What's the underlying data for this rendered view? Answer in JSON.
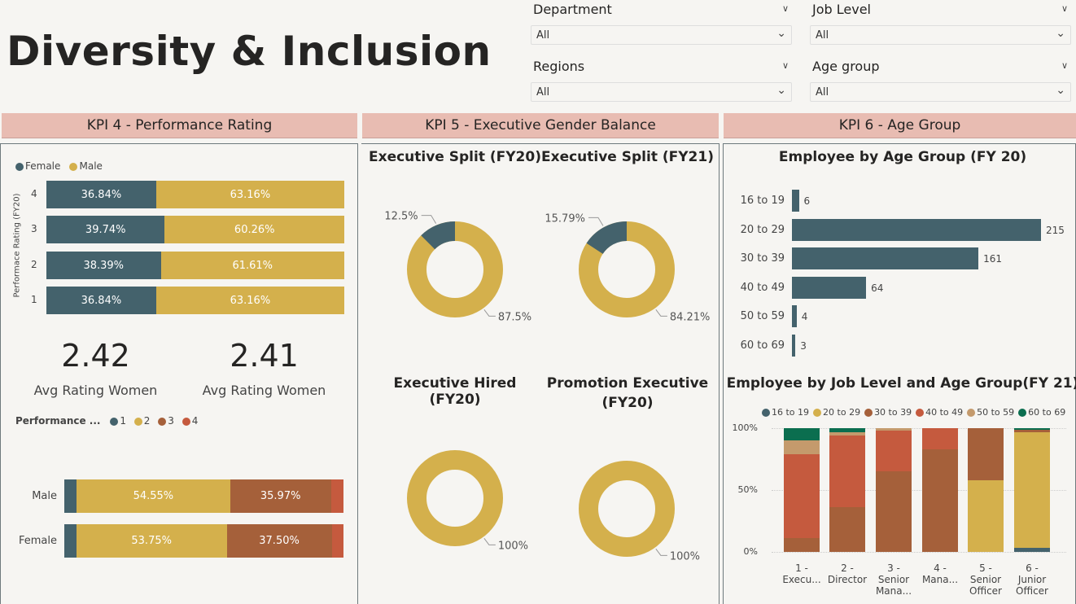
{
  "header": {
    "title": "Diversity & Inclusion"
  },
  "filters": [
    {
      "label": "Department",
      "value": "All"
    },
    {
      "label": "Job Level",
      "value": "All"
    },
    {
      "label": "Regions",
      "value": "All"
    },
    {
      "label": "Age group",
      "value": "All"
    }
  ],
  "kpi_headers": {
    "kpi4": "KPI 4 - Performance Rating",
    "kpi5": "KPI 5 - Executive Gender Balance",
    "kpi6": "KPI 6 - Age Group"
  },
  "colors": {
    "teal": "#44626c",
    "gold": "#d4b04c",
    "brown": "#a5603a",
    "red": "#c55a3e",
    "tan": "#c49a6c",
    "green": "#0b6e4f"
  },
  "perf_chart": {
    "legend": [
      "Female",
      "Male"
    ],
    "y_axis_label": "Performace Rating (FY20)",
    "rows": [
      {
        "rating": "4",
        "female": "36.84%",
        "male": "63.16%",
        "f": 36.84
      },
      {
        "rating": "3",
        "female": "39.74%",
        "male": "60.26%",
        "f": 39.74
      },
      {
        "rating": "2",
        "female": "38.39%",
        "male": "61.61%",
        "f": 38.39
      },
      {
        "rating": "1",
        "female": "36.84%",
        "male": "63.16%",
        "f": 36.84
      }
    ]
  },
  "cards": [
    {
      "value": "2.42",
      "label": "Avg Rating Women"
    },
    {
      "value": "2.41",
      "label": "Avg Rating Women"
    }
  ],
  "perf_dist": {
    "legend_title": "Performance ...",
    "legend": [
      "1",
      "2",
      "3",
      "4"
    ],
    "rows": [
      {
        "label": "Male",
        "s1": 4.4,
        "s2": 54.55,
        "s3": 35.97,
        "s4": 4.4,
        "l2": "54.55%",
        "l3": "35.97%"
      },
      {
        "label": "Female",
        "s1": 4.3,
        "s2": 53.75,
        "s3": 37.5,
        "s4": 4.2,
        "l2": "53.75%",
        "l3": "37.50%"
      }
    ]
  },
  "donuts": [
    {
      "title": "Executive Split (FY20)",
      "small": "12.5%",
      "large": "87.5%",
      "frac": 0.125
    },
    {
      "title": "Executive Split (FY21)",
      "small": "15.79%",
      "large": "84.21%",
      "frac": 0.1579
    },
    {
      "title": "Executive Hired (FY20)",
      "small": "",
      "large": "100%",
      "frac": 0
    },
    {
      "title_line1": "Promotion Executive",
      "title_line2": "(FY20)",
      "small": "",
      "large": "100%",
      "frac": 0
    }
  ],
  "chart_data": [
    {
      "type": "bar",
      "title": "Employee by Age Group (FY 20)",
      "categories": [
        "16 to 19",
        "20 to 29",
        "30 to 39",
        "40 to 49",
        "50 to 59",
        "60 to 69"
      ],
      "values": [
        6,
        215,
        161,
        64,
        4,
        3
      ],
      "value_labels": [
        "6",
        "215",
        "161",
        "64",
        "4",
        "3"
      ]
    },
    {
      "type": "bar",
      "title": "Employee by Job Level and Age Group(FY 21)",
      "legend": [
        "16 to 19",
        "20 to 29",
        "30 to 39",
        "40 to 49",
        "50 to 59",
        "60 to 69"
      ],
      "y_ticks": [
        "100%",
        "50%",
        "0%"
      ],
      "categories": [
        [
          "1 -",
          "Execu..."
        ],
        [
          "2 -",
          "Director"
        ],
        [
          "3 -",
          "Senior",
          "Mana..."
        ],
        [
          "4 -",
          "Mana..."
        ],
        [
          "5 -",
          "Senior",
          "Officer"
        ],
        [
          "6 -",
          "Junior",
          "Officer"
        ]
      ],
      "series": [
        {
          "name": "16 to 19",
          "values": [
            0,
            0,
            0,
            0,
            0,
            3
          ]
        },
        {
          "name": "20 to 29",
          "values": [
            0,
            0,
            0,
            0,
            58,
            94
          ]
        },
        {
          "name": "30 to 39",
          "values": [
            11,
            36,
            65,
            83,
            42,
            2
          ]
        },
        {
          "name": "40 to 49",
          "values": [
            68,
            58,
            33,
            17,
            0,
            0
          ]
        },
        {
          "name": "50 to 59",
          "values": [
            11,
            3,
            2,
            0,
            0,
            0
          ]
        },
        {
          "name": "60 to 69",
          "values": [
            10,
            3,
            0,
            0,
            0,
            1
          ]
        }
      ]
    }
  ]
}
